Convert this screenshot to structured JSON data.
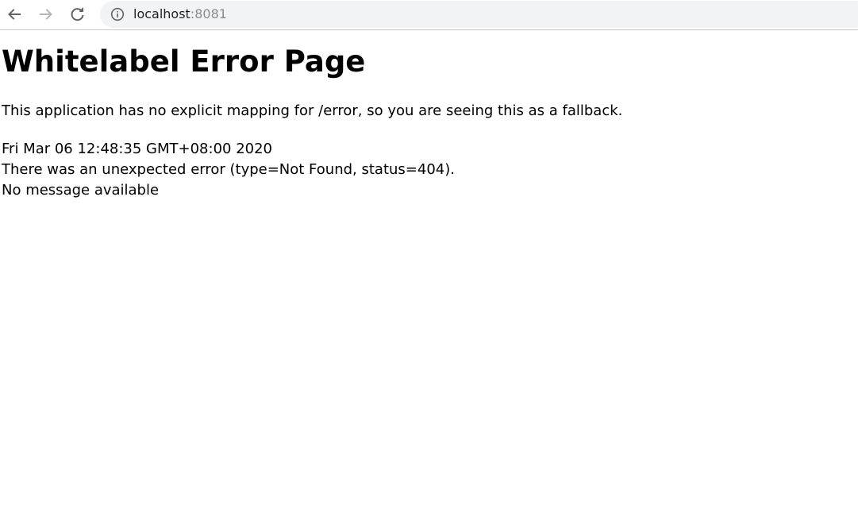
{
  "browser": {
    "url_host": "localhost",
    "url_port": ":8081",
    "icons": {
      "back": "back-arrow-icon",
      "forward": "forward-arrow-icon",
      "reload": "reload-icon",
      "site_info": "info-circle-icon"
    }
  },
  "page": {
    "title": "Whitelabel Error Page",
    "fallback_message": "This application has no explicit mapping for /error, so you are seeing this as a fallback.",
    "timestamp": "Fri Mar 06 12:48:35 GMT+08:00 2020",
    "error_line": "There was an unexpected error (type=Not Found, status=404).",
    "message_line": "No message available"
  }
}
